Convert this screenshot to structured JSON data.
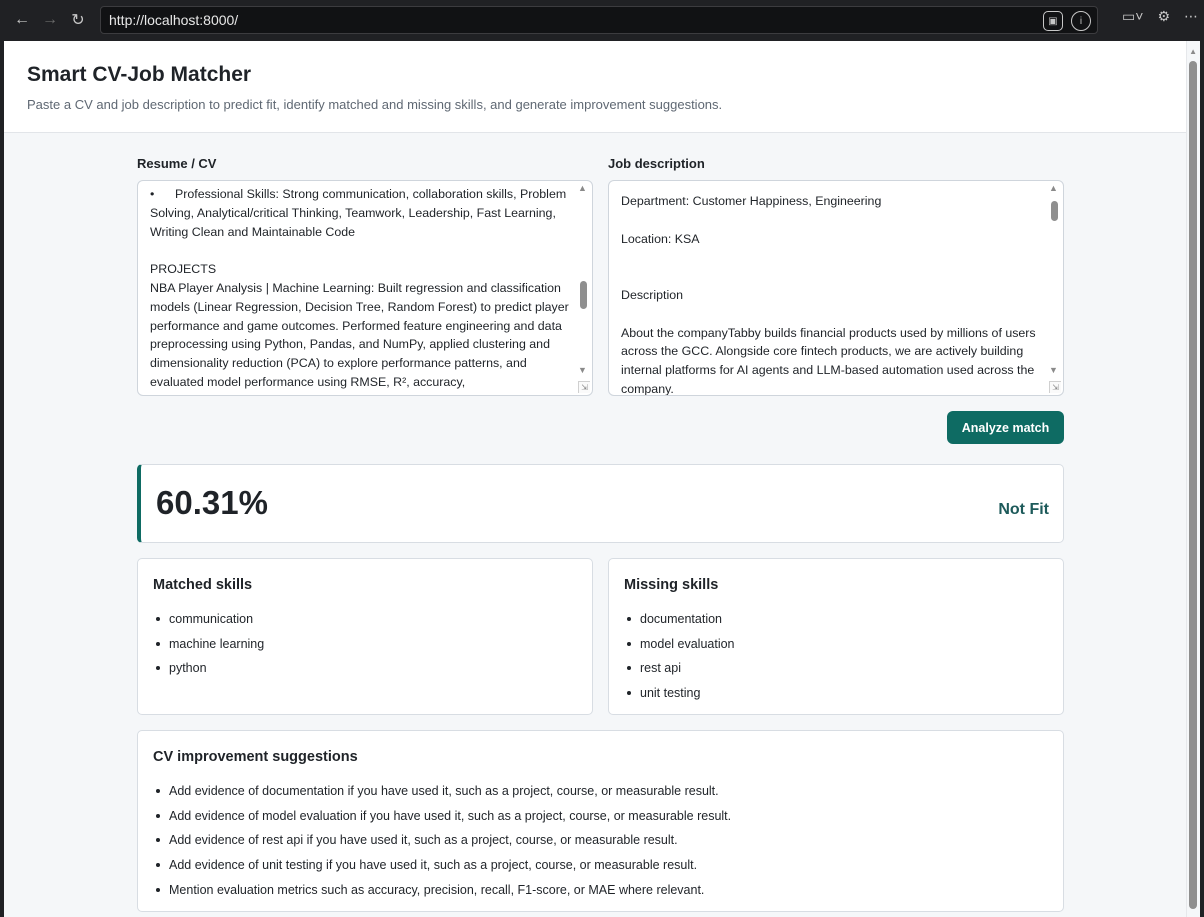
{
  "browser": {
    "url": "http://localhost:8000/"
  },
  "header": {
    "title": "Smart CV-Job Matcher",
    "subtitle": "Paste a CV and job description to predict fit, identify matched and missing skills, and generate improvement suggestions."
  },
  "resume": {
    "label": "Resume / CV",
    "value": "•      Professional Skills: Strong communication, collaboration skills, Problem Solving, Analytical/critical Thinking, Teamwork, Leadership, Fast Learning, Writing Clean and Maintainable Code\n\nPROJECTS\nNBA Player Analysis | Machine Learning: Built regression and classification models (Linear Regression, Decision Tree, Random Forest) to predict player performance and game outcomes. Performed feature engineering and data preprocessing using Python, Pandas, and NumPy, applied clustering and dimensionality reduction (PCA) to explore performance patterns, and evaluated model performance using RMSE, R², accuracy,"
  },
  "job": {
    "label": "Job description",
    "value": "Department: Customer Happiness, Engineering\n\nLocation: KSA\n\n\nDescription\n\nAbout the companyTabby builds financial products used by millions of users across the GCC. Alongside core fintech products, we are actively building internal platforms for AI agents and LLM-based automation used across the company."
  },
  "actions": {
    "analyze_label": "Analyze match"
  },
  "result": {
    "score": "60.31%",
    "verdict": "Not Fit"
  },
  "matched": {
    "title": "Matched skills",
    "items": [
      "communication",
      "machine learning",
      "python"
    ]
  },
  "missing": {
    "title": "Missing skills",
    "items": [
      "documentation",
      "model evaluation",
      "rest api",
      "unit testing"
    ]
  },
  "suggestions": {
    "title": "CV improvement suggestions",
    "items": [
      "Add evidence of documentation if you have used it, such as a project, course, or measurable result.",
      "Add evidence of model evaluation if you have used it, such as a project, course, or measurable result.",
      "Add evidence of rest api if you have used it, such as a project, course, or measurable result.",
      "Add evidence of unit testing if you have used it, such as a project, course, or measurable result.",
      "Mention evaluation metrics such as accuracy, precision, recall, F1-score, or MAE where relevant."
    ]
  },
  "colors": {
    "accent": "#0e6b63",
    "verdict": "#1d5a5a"
  }
}
